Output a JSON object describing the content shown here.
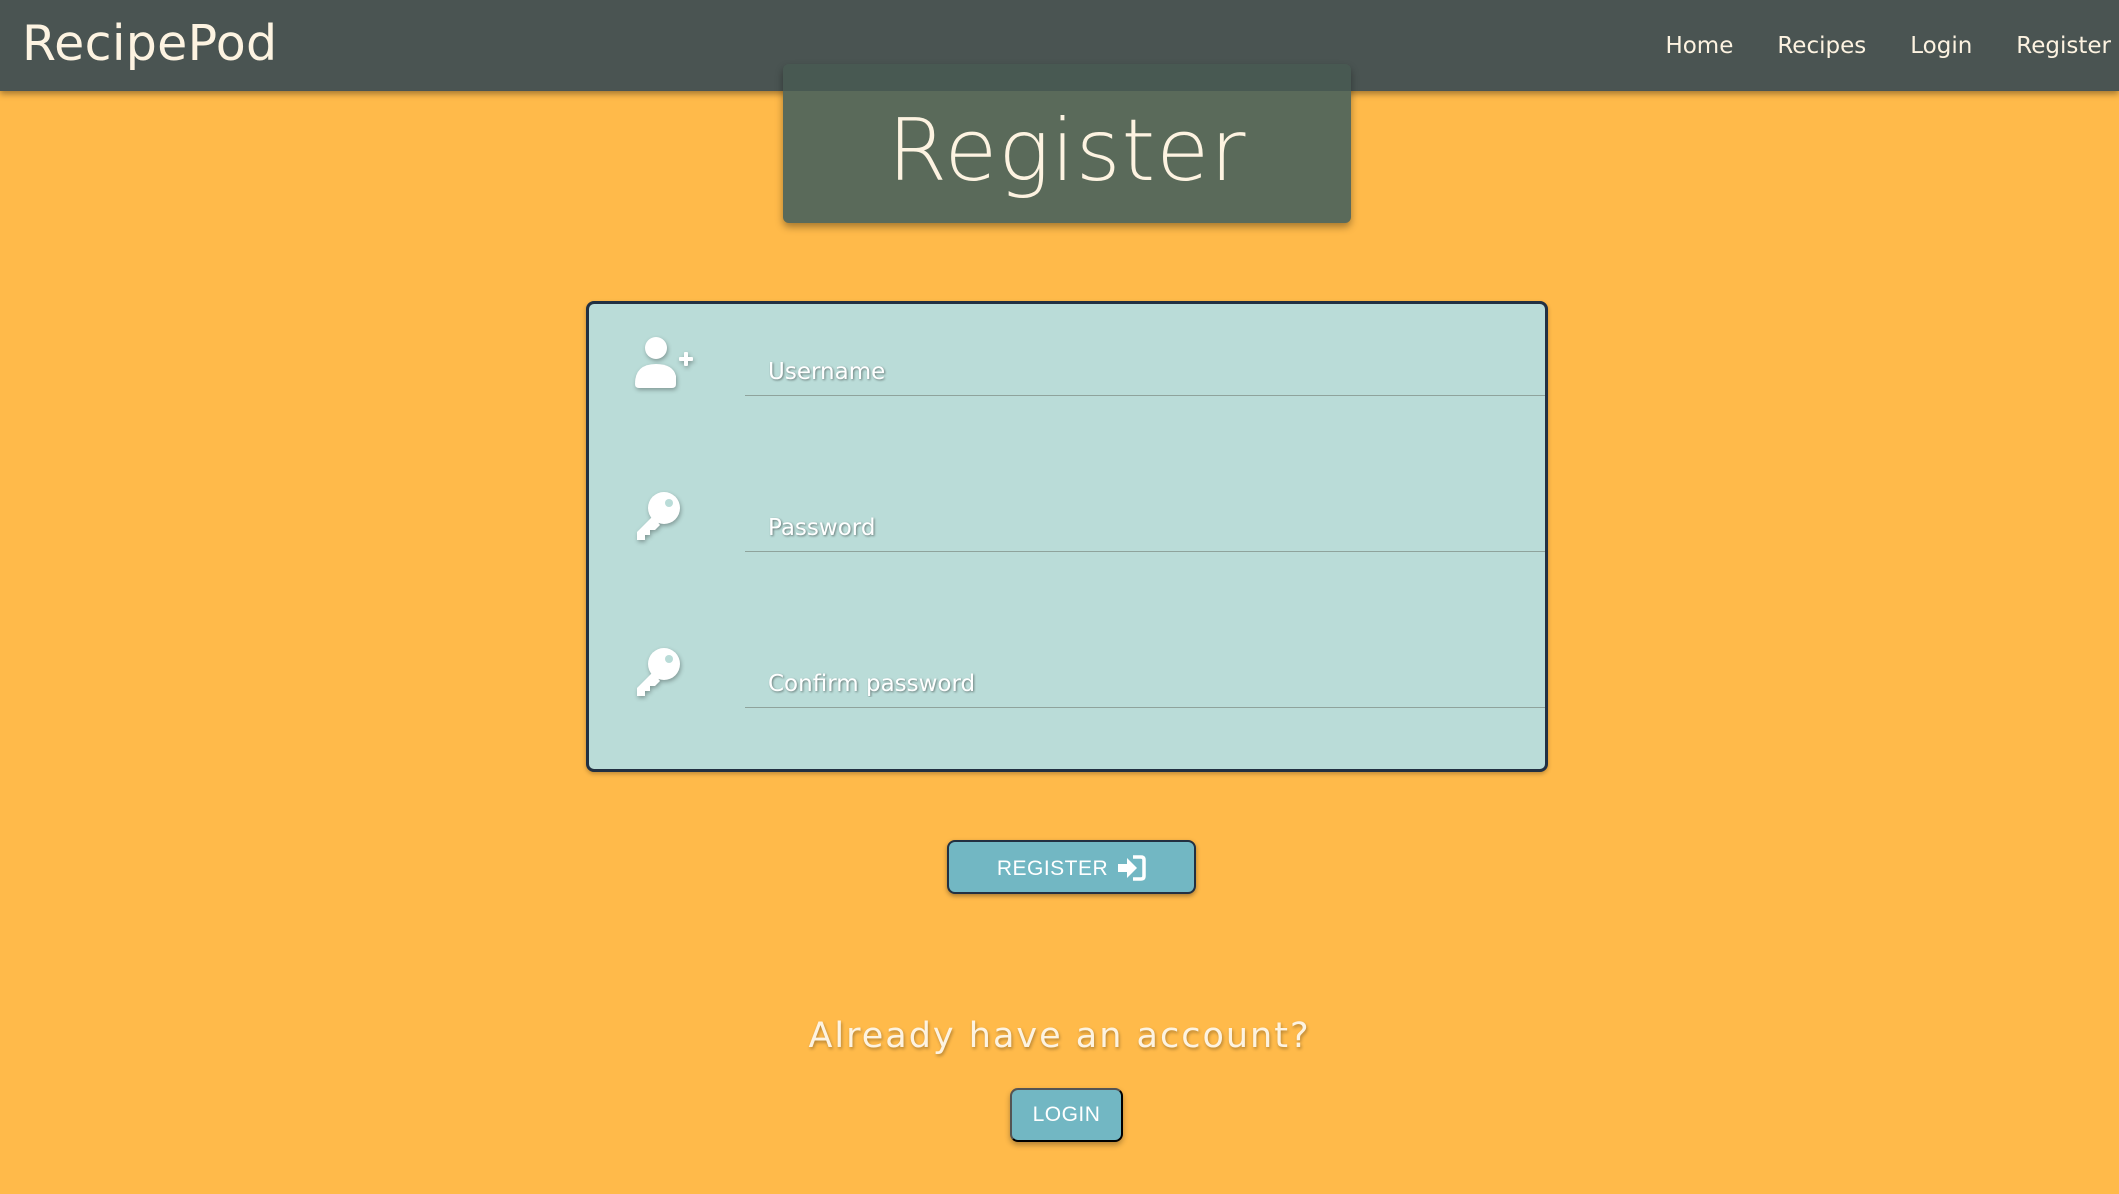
{
  "navbar": {
    "brand": "RecipePod",
    "links": [
      {
        "label": "Home"
      },
      {
        "label": "Recipes"
      },
      {
        "label": "Login"
      },
      {
        "label": "Register"
      }
    ]
  },
  "page": {
    "title": "Register"
  },
  "form": {
    "username": {
      "placeholder": "Username",
      "value": "",
      "icon": "user-plus-icon"
    },
    "password": {
      "placeholder": "Password",
      "value": "",
      "icon": "key-icon"
    },
    "confirm_password": {
      "placeholder": "Confirm password",
      "value": "",
      "icon": "key-icon"
    }
  },
  "register_button": {
    "label": "REGISTER",
    "icon": "sign-in-icon"
  },
  "login_prompt": {
    "text": "Already have an account?",
    "button_label": "LOGIN"
  },
  "colors": {
    "background": "#FFBA4A",
    "navbar": "#4A5452",
    "title_box": "#5A6A5A",
    "form_card": "#BADCD8",
    "button": "#72B7C3",
    "text_light": "#FDF3E1"
  }
}
